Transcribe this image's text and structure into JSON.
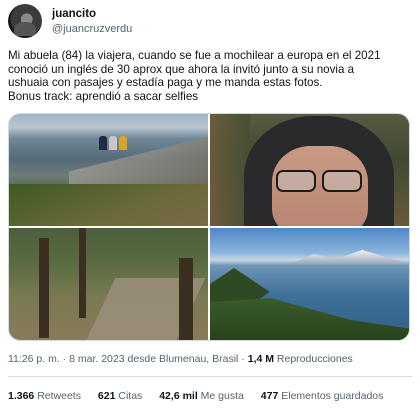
{
  "author": {
    "display_name": "juancito",
    "handle": "@juancruzverdu"
  },
  "tweet": {
    "lines": [
      "Mi abuela (84)  la viajera, cuando se fue a mochilear a europa en el 2021",
      "conoció un inglés de 30 aprox que ahora la invitó junto a su novia a",
      "ushuaia con pasajes y estadía paga y me manda estas fotos.",
      "Bonus track: aprendió a sacar selfies"
    ]
  },
  "media": {
    "photos": [
      "coastal-hill-photo",
      "selfie-photo",
      "forest-path-photo",
      "bay-view-photo"
    ]
  },
  "meta": {
    "time": "11:26 p. m.",
    "separator": " · ",
    "date_source": "8 mar. 2023 desde Blumenau, Brasil",
    "views_count": "1,4 M",
    "views_label": "Reproducciones"
  },
  "stats": {
    "retweets_count": "1.366",
    "retweets_label": "Retweets",
    "quotes_count": "621",
    "quotes_label": "Citas",
    "likes_count": "42,6 mil",
    "likes_label": "Me gusta",
    "bookmarks_count": "477",
    "bookmarks_label": "Elementos guardados"
  },
  "colors": {
    "text_primary": "#0f1419",
    "text_secondary": "#536471",
    "border": "#cfd9de"
  }
}
